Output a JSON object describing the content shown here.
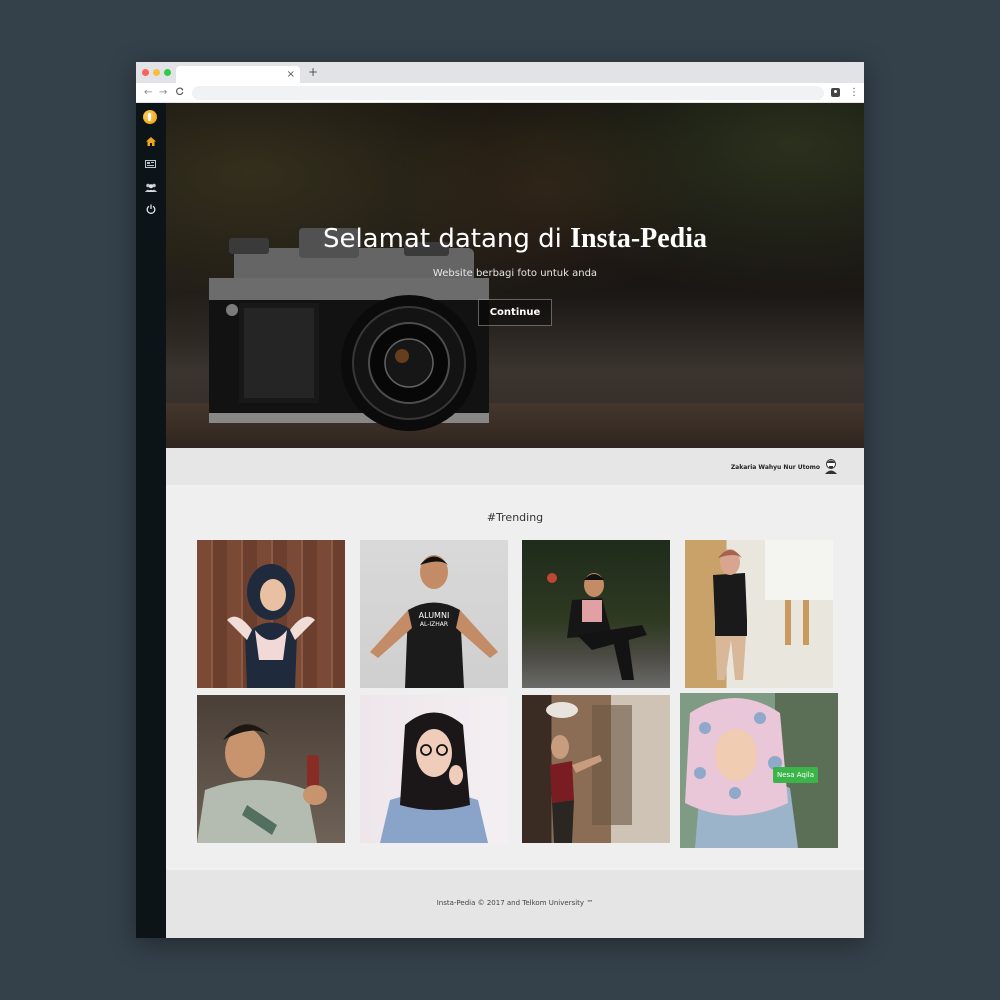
{
  "browser": {
    "tab_close": "×",
    "new_tab": "+",
    "back": "←",
    "forward": "→",
    "reload": "C",
    "menu": "⋮"
  },
  "hero": {
    "title_prefix": "Selamat datang di",
    "title_brand": "Insta-Pedia",
    "subtitle": "Website berbagi foto untuk anda",
    "button": "Continue"
  },
  "author": {
    "name": "Zakaria Wahyu Nur Utomo"
  },
  "trending": {
    "title": "#Trending",
    "photos": [
      {
        "label": ""
      },
      {
        "label": ""
      },
      {
        "label": ""
      },
      {
        "label": ""
      },
      {
        "label": ""
      },
      {
        "label": ""
      },
      {
        "label": ""
      },
      {
        "label": "Nesa Aqila"
      }
    ]
  },
  "footer": {
    "text": "Insta-Pedia © 2017 and Telkom University ™"
  },
  "sidebar": {
    "icons": [
      "home-icon",
      "gallery-icon",
      "users-icon",
      "power-icon"
    ]
  },
  "colors": {
    "sidebar": "#0d1418",
    "accent_logo": "#f2a81d",
    "label_green": "#3bb54a",
    "page_bg": "#efefef"
  }
}
